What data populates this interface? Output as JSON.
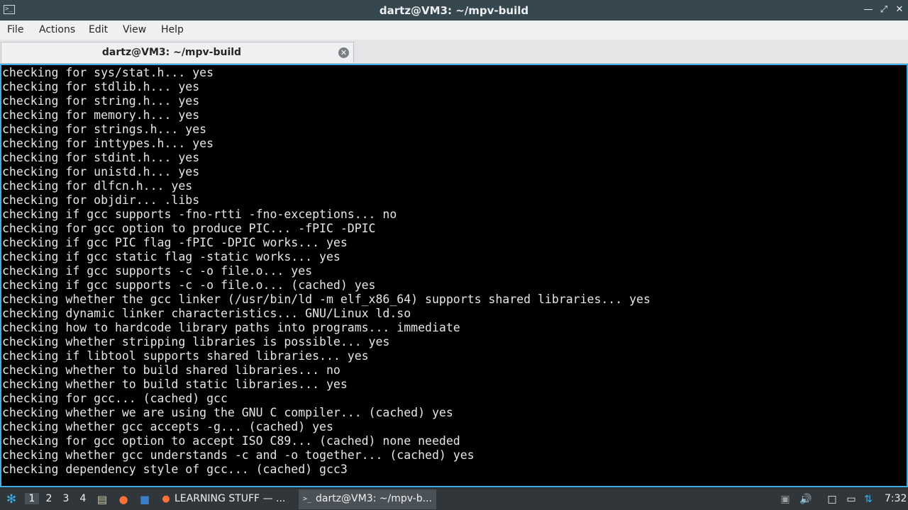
{
  "window": {
    "title": "dartz@VM3: ~/mpv-build",
    "icon": "terminal-window-icon",
    "controls": {
      "minimize": "—",
      "maximize": "⤢",
      "close": "✕"
    }
  },
  "menu": [
    "File",
    "Actions",
    "Edit",
    "View",
    "Help"
  ],
  "tab": {
    "label": "dartz@VM3: ~/mpv-build",
    "close": "✕"
  },
  "terminal": {
    "lines": [
      "checking for sys/stat.h... yes",
      "checking for stdlib.h... yes",
      "checking for string.h... yes",
      "checking for memory.h... yes",
      "checking for strings.h... yes",
      "checking for inttypes.h... yes",
      "checking for stdint.h... yes",
      "checking for unistd.h... yes",
      "checking for dlfcn.h... yes",
      "checking for objdir... .libs",
      "checking if gcc supports -fno-rtti -fno-exceptions... no",
      "checking for gcc option to produce PIC... -fPIC -DPIC",
      "checking if gcc PIC flag -fPIC -DPIC works... yes",
      "checking if gcc static flag -static works... yes",
      "checking if gcc supports -c -o file.o... yes",
      "checking if gcc supports -c -o file.o... (cached) yes",
      "checking whether the gcc linker (/usr/bin/ld -m elf_x86_64) supports shared libraries... yes",
      "checking dynamic linker characteristics... GNU/Linux ld.so",
      "checking how to hardcode library paths into programs... immediate",
      "checking whether stripping libraries is possible... yes",
      "checking if libtool supports shared libraries... yes",
      "checking whether to build shared libraries... no",
      "checking whether to build static libraries... yes",
      "checking for gcc... (cached) gcc",
      "checking whether we are using the GNU C compiler... (cached) yes",
      "checking whether gcc accepts -g... (cached) yes",
      "checking for gcc option to accept ISO C89... (cached) none needed",
      "checking whether gcc understands -c and -o together... (cached) yes",
      "checking dependency style of gcc... (cached) gcc3"
    ]
  },
  "taskbar": {
    "start_icon": "lubuntu-start-icon",
    "workspaces": [
      "1",
      "2",
      "3",
      "4"
    ],
    "active_workspace": "1",
    "quicklaunch": [
      {
        "name": "show-desktop-icon",
        "glyph": "▤"
      },
      {
        "name": "firefox-icon",
        "glyph": "●"
      },
      {
        "name": "file-manager-icon",
        "glyph": "■"
      }
    ],
    "tasks": [
      {
        "label": "LEARNING STUFF — ...",
        "icon": "firefox-icon"
      },
      {
        "label": "dartz@VM3: ~/mpv-b...",
        "icon": "terminal-icon"
      }
    ],
    "tray": [
      {
        "name": "update-notifier-icon",
        "glyph": "▣"
      },
      {
        "name": "volume-icon",
        "glyph": "🔊"
      },
      {
        "name": "clipboard-icon",
        "glyph": "□"
      },
      {
        "name": "monitor-icon",
        "glyph": "▭"
      },
      {
        "name": "network-icon",
        "glyph": "⇅"
      }
    ],
    "clock": "7:32"
  }
}
